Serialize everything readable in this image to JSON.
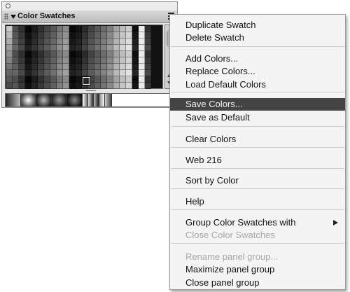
{
  "panel": {
    "title": "Color Swatches",
    "icons": [
      "grip-icon",
      "collapse-triangle-icon",
      "panel-options-icon",
      "close-dot-icon"
    ]
  },
  "menu": {
    "sections": [
      [
        {
          "label": "Duplicate Swatch",
          "enabled": true
        },
        {
          "label": "Delete Swatch",
          "enabled": true
        }
      ],
      [
        {
          "label": "Add Colors...",
          "enabled": true
        },
        {
          "label": "Replace Colors...",
          "enabled": true
        },
        {
          "label": "Load Default Colors",
          "enabled": true
        }
      ],
      [
        {
          "label": "Save Colors...",
          "enabled": true,
          "highlighted": true
        },
        {
          "label": "Save as Default",
          "enabled": true
        }
      ],
      [
        {
          "label": "Clear Colors",
          "enabled": true
        }
      ],
      [
        {
          "label": "Web 216",
          "enabled": true
        }
      ],
      [
        {
          "label": "Sort by Color",
          "enabled": true
        }
      ],
      [
        {
          "label": "Help",
          "enabled": true
        }
      ],
      [
        {
          "label": "Group Color Swatches with",
          "enabled": true,
          "submenu": true
        },
        {
          "label": "Close Color Swatches",
          "enabled": false
        }
      ],
      [
        {
          "label": "Rename panel group...",
          "enabled": false
        },
        {
          "label": "Maximize panel group",
          "enabled": true
        },
        {
          "label": "Close panel group",
          "enabled": true
        }
      ]
    ]
  }
}
